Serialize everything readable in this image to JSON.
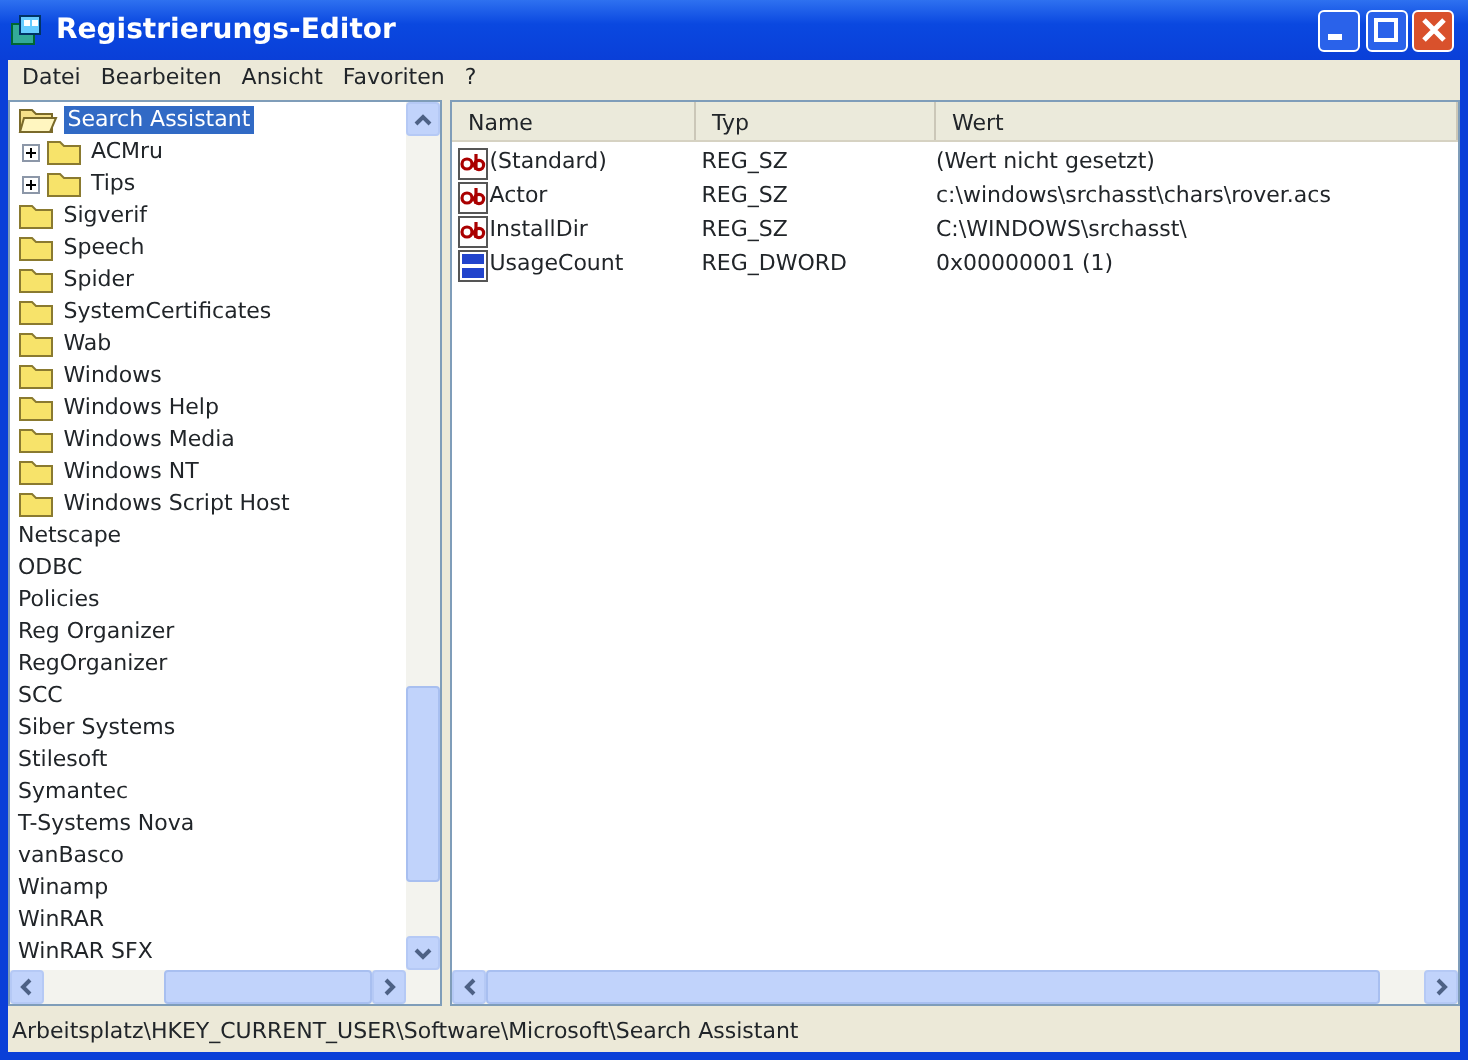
{
  "window": {
    "title": "Registrierungs-Editor"
  },
  "menu": [
    "Datei",
    "Bearbeiten",
    "Ansicht",
    "Favoriten",
    "?"
  ],
  "tree": {
    "items": [
      {
        "children": [
          {
            "label": "Search Assistant",
            "selected": true,
            "expanded": true,
            "children": [
              {
                "label": "ACMru",
                "selected": false,
                "expanded": false
              },
              {
                "label": "Tips",
                "selected": false,
                "expanded": false
              }
            ]
          },
          {
            "label": "Sigverif",
            "selected": false
          },
          {
            "label": "Speech",
            "selected": false
          },
          {
            "label": "Spider",
            "selected": false
          },
          {
            "label": "SystemCertificates",
            "selected": false
          },
          {
            "label": "Wab",
            "selected": false
          },
          {
            "label": "Windows",
            "selected": false
          },
          {
            "label": "Windows Help",
            "selected": false
          },
          {
            "label": "Windows Media",
            "selected": false
          },
          {
            "label": "Windows NT",
            "selected": false
          },
          {
            "label": "Windows Script Host",
            "selected": false
          }
        ]
      },
      {
        "label": "Netscape",
        "selected": false
      },
      {
        "label": "ODBC",
        "selected": false
      },
      {
        "label": "Policies",
        "selected": false
      },
      {
        "label": "Reg Organizer",
        "selected": false
      },
      {
        "label": "RegOrganizer",
        "selected": false
      },
      {
        "label": "SCC",
        "selected": false
      },
      {
        "label": "Siber Systems",
        "selected": false
      },
      {
        "label": "Stilesoft",
        "selected": false
      },
      {
        "label": "Symantec",
        "selected": false
      },
      {
        "label": "T-Systems Nova",
        "selected": false
      },
      {
        "label": "vanBasco",
        "selected": false
      },
      {
        "label": "Winamp",
        "selected": false
      },
      {
        "label": "WinRAR",
        "selected": false
      },
      {
        "label": "WinRAR SFX",
        "selected": false
      }
    ]
  },
  "values": {
    "columns": [
      "Name",
      "Typ",
      "Wert"
    ],
    "rows": [
      {
        "kind": "string",
        "name": "(Standard)",
        "type": "REG_SZ",
        "data": "(Wert nicht gesetzt)"
      },
      {
        "kind": "string",
        "name": "Actor",
        "type": "REG_SZ",
        "data": "c:\\windows\\srchasst\\chars\\rover.acs"
      },
      {
        "kind": "string",
        "name": "InstallDir",
        "type": "REG_SZ",
        "data": "C:\\WINDOWS\\srchasst\\"
      },
      {
        "kind": "dword",
        "name": "UsageCount",
        "type": "REG_DWORD",
        "data": "0x00000001 (1)"
      }
    ]
  },
  "status_bar": "Arbeitsplatz\\HKEY_CURRENT_USER\\Software\\Microsoft\\Search Assistant"
}
